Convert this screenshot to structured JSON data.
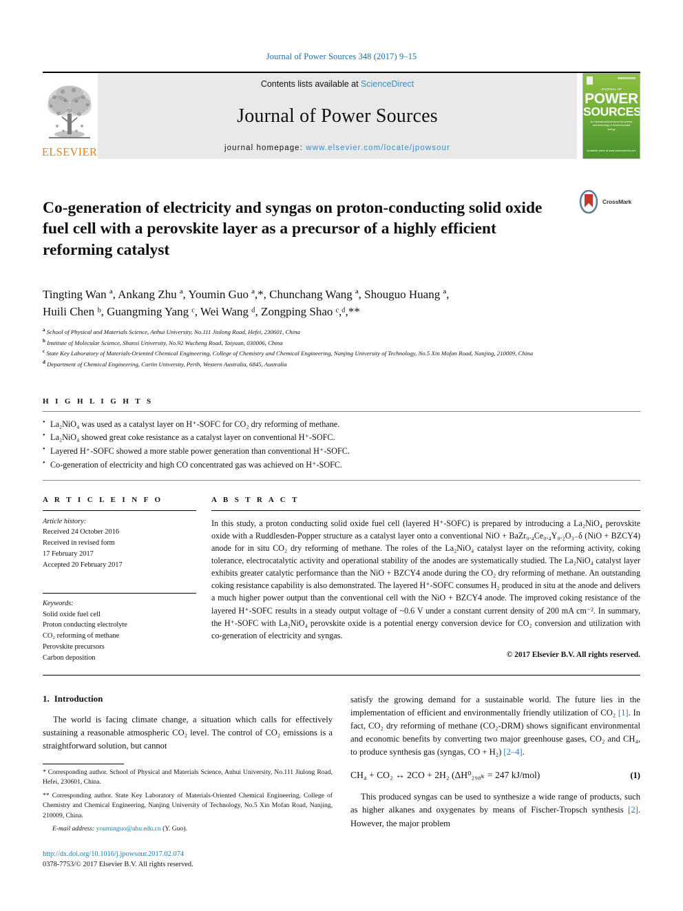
{
  "running_head": "Journal of Power Sources 348 (2017) 9–15",
  "banner": {
    "contents_prefix": "Contents lists available at ",
    "sciencedirect": "ScienceDirect",
    "journal_title": "Journal of Power Sources",
    "homepage_label": "journal homepage: ",
    "homepage_url": "www.elsevier.com/locate/jpowsour",
    "publisher": "ELSEVIER",
    "cover": {
      "tag": "JOURNAL OF",
      "line1": "POWER",
      "line2": "SOURCES",
      "desc": "An international journal on the science and technology of electrochemical energy",
      "footer": "Available online at www.sciencedirect.com"
    },
    "accent_link": "#3a8fc4",
    "elsevier_orange": "#ec8024",
    "cover_green": "#77b33a"
  },
  "crossmark": {
    "label": "CrossMark"
  },
  "article": {
    "title": "Co-generation of electricity and syngas on proton-conducting solid oxide fuel cell with a perovskite layer as a precursor of a highly efficient reforming catalyst",
    "authors_line1": "Tingting Wan ª, Ankang Zhu ª, Youmin Guo ª,*, Chunchang Wang ª, Shouguo Huang ª,",
    "authors_line2": "Huili Chen ᵇ, Guangming Yang ᶜ, Wei Wang ᵈ, Zongping Shao ᶜ,ᵈ,**",
    "affiliations": [
      {
        "marker": "a",
        "text": "School of Physical and Materials Science, Anhui University, No.111 Jiulong Road, Hefei, 230601, China"
      },
      {
        "marker": "b",
        "text": "Institute of Molecular Science, Shanxi University, No.92 Wucheng Road, Taiyuan, 030006, China"
      },
      {
        "marker": "c",
        "text": "State Key Laboratory of Materials-Oriented Chemical Engineering, College of Chemistry and Chemical Engineering, Nanjing University of Technology, No.5 Xin Mofan Road, Nanjing, 210009, China"
      },
      {
        "marker": "d",
        "text": "Department of Chemical Engineering, Curtin University, Perth, Western Australia, 6845, Australia"
      }
    ]
  },
  "highlights": {
    "heading": "H I G H L I G H T S",
    "items": [
      "La₂NiO₄ was used as a catalyst layer on H⁺-SOFC for CO₂ dry reforming of methane.",
      "La₂NiO₄ showed great coke resistance as a catalyst layer on conventional H⁺-SOFC.",
      "Layered H⁺-SOFC showed a more stable power generation than conventional H⁺-SOFC.",
      "Co-generation of electricity and high CO concentrated gas was achieved on H⁺-SOFC."
    ]
  },
  "article_info": {
    "heading": "A R T I C L E   I N F O",
    "history_label": "Article history:",
    "history": [
      "Received 24 October 2016",
      "Received in revised form",
      "17 February 2017",
      "Accepted 20 February 2017"
    ],
    "keywords_label": "Keywords:",
    "keywords": [
      "Solid oxide fuel cell",
      "Proton conducting electrolyte",
      "CO₂ reforming of methane",
      "Perovskite precursors",
      "Carbon deposition"
    ]
  },
  "abstract": {
    "heading": "A B S T R A C T",
    "text": "In this study, a proton conducting solid oxide fuel cell (layered H⁺-SOFC) is prepared by introducing a La₂NiO₄ perovskite oxide with a Ruddlesden-Popper structure as a catalyst layer onto a conventional NiO + BaZr₀.₄Ce₀.₄Y₀.₂O₃₋δ (NiO + BZCY4) anode for in situ CO₂ dry reforming of methane. The roles of the La₂NiO₄ catalyst layer on the reforming activity, coking tolerance, electrocatalytic activity and operational stability of the anodes are systematically studied. The La₂NiO₄ catalyst layer exhibits greater catalytic performance than the NiO + BZCY4 anode during the CO₂ dry reforming of methane. An outstanding coking resistance capability is also demonstrated. The layered H⁺-SOFC consumes H₂ produced in situ at the anode and delivers a much higher power output than the conventional cell with the NiO + BZCY4 anode. The improved coking resistance of the layered H⁺-SOFC results in a steady output voltage of ~0.6 V under a constant current density of 200 mA cm⁻². In summary, the H⁺-SOFC with La₂NiO₄ perovskite oxide is a potential energy conversion device for CO₂ conversion and utilization with co-generation of electricity and syngas.",
    "copyright": "© 2017 Elsevier B.V. All rights reserved."
  },
  "introduction": {
    "heading_number": "1.",
    "heading_title": "Introduction",
    "para_left": "The world is facing climate change, a situation which calls for effectively sustaining a reasonable atmospheric CO₂ level. The control of CO₂ emissions is a straightforward solution, but cannot",
    "para_right_1": "satisfy the growing demand for a sustainable world. The future lies in the implementation of efficient and environmentally friendly utilization of CO₂ [1]. In fact, CO₂ dry reforming of methane (CO₂-DRM) shows significant environmental and economic benefits by converting two major greenhouse gases, CO₂ and CH₄, to produce synthesis gas (syngas, CO + H₂) [2–4].",
    "ref_1": "[1]",
    "ref_24": "[2–4]",
    "ref_2": "[2]",
    "equation": "CH₄ + CO₂ ↔ 2CO + 2H₂ (ΔH⁰₂₉₈ₖ = 247 kJ/mol)",
    "equation_number": "(1)",
    "para_right_2": "This produced syngas can be used to synthesize a wide range of products, such as higher alkanes and oxygenates by means of Fischer-Tropsch synthesis [2]. However, the major problem"
  },
  "footnotes": {
    "corresponding_1": "* Corresponding author. School of Physical and Materials Science, Anhui University, No.111 Jiulong Road, Hefei, 230601, China.",
    "corresponding_2": "** Corresponding author. State Key Laboratory of Materials-Oriented Chemical Engineering, College of Chemistry and Chemical Engineering, Nanjing University of Technology, No.5 Xin Mofan Road, Nanjing, 210009, China.",
    "email_label": "E-mail address:",
    "email": "youminguo@ahu.edu.cn",
    "email_owner": "(Y. Guo).",
    "doi": "http://dx.doi.org/10.1016/j.jpowsour.2017.02.074",
    "issn_line": "0378-7753/© 2017 Elsevier B.V. All rights reserved."
  }
}
